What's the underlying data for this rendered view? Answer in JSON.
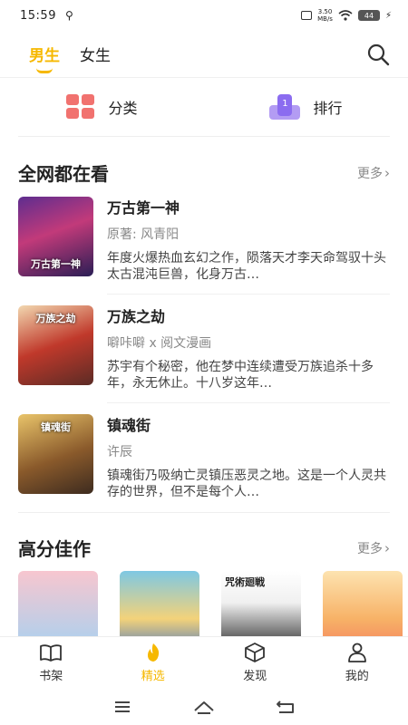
{
  "status_bar": {
    "time": "15:59",
    "usb_icon": "usb-icon",
    "net_speed_value": "3.50",
    "net_speed_unit": "MB/s",
    "battery": "44"
  },
  "top_nav": {
    "tabs": [
      {
        "label": "男生",
        "active": true
      },
      {
        "label": "女生",
        "active": false
      }
    ],
    "search_icon": "search-icon"
  },
  "quick_nav": {
    "category_label": "分类",
    "ranking_label": "排行",
    "ranking_badge": "1"
  },
  "section_popular": {
    "title": "全网都在看",
    "more": "更多"
  },
  "books": [
    {
      "title": "万古第一神",
      "author": "原著: 风青阳",
      "desc": "年度火爆热血玄幻之作，陨落天才李天命驾驭十头太古混沌巨兽，化身万古…",
      "cover_text": "万古第一神"
    },
    {
      "title": "万族之劫",
      "author": "噼咔噼 x 阅文漫画",
      "desc": "苏宇有个秘密，他在梦中连续遭受万族追杀十多年，永无休止。十八岁这年…",
      "cover_text": "万族之劫"
    },
    {
      "title": "镇魂街",
      "author": "许辰",
      "desc": "镇魂街乃吸纳亡灵镇压恶灵之地。这是一个人灵共存的世界，但不是每个人…",
      "cover_text": "镇魂街"
    }
  ],
  "section_high_score": {
    "title": "高分佳作",
    "more": "更多",
    "cover_labels": [
      "",
      "",
      "咒術廻戦",
      ""
    ]
  },
  "tab_bar": {
    "items": [
      {
        "label": "书架",
        "icon": "book-icon",
        "active": false
      },
      {
        "label": "精选",
        "icon": "flame-icon",
        "active": true
      },
      {
        "label": "发现",
        "icon": "cube-icon",
        "active": false
      },
      {
        "label": "我的",
        "icon": "user-icon",
        "active": false
      }
    ]
  },
  "colors": {
    "accent": "#f6b800",
    "category_icon": "#f1726f",
    "ranking_icon": "#8b6cf0"
  }
}
